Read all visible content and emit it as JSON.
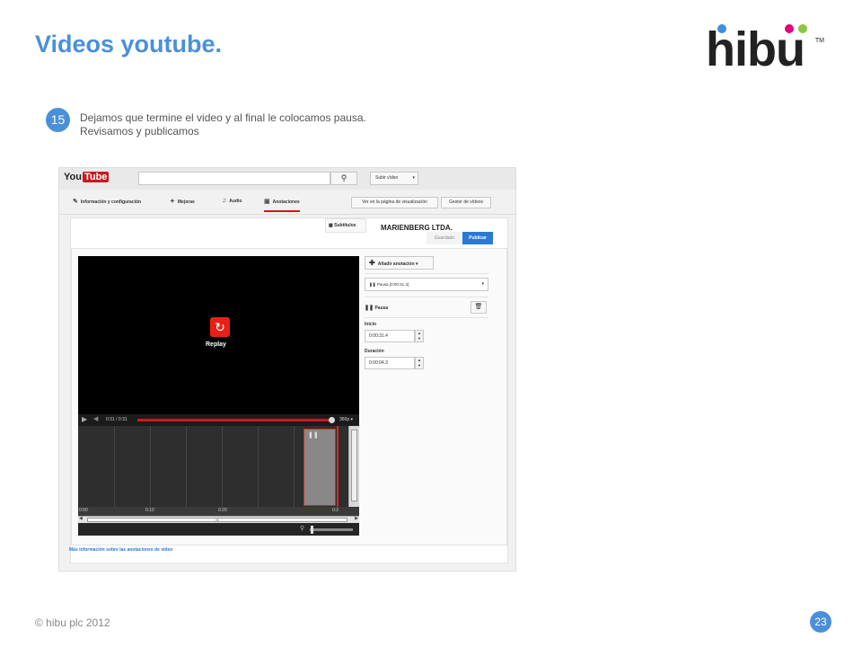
{
  "slide": {
    "title": "Videos youtube.",
    "step_number": "15",
    "step_line1": "Dejamos que termine el video y al final le colocamos pausa.",
    "step_line2": "Revisamos y publicamos",
    "footer": "© hibu plc 2012",
    "page_number": "23"
  },
  "logo": {
    "text": "hibu",
    "tm": "TM",
    "dot_colors": [
      "#3f8fdd",
      "#e4007e",
      "#8cc63f"
    ]
  },
  "youtube": {
    "logo_you": "You",
    "logo_tube": "Tube",
    "search_icon": "search-icon",
    "upload_label": "Subir vídeo",
    "tabs": [
      {
        "label": "Información y configuración",
        "icon": "pencil-icon"
      },
      {
        "label": "Mejoras",
        "icon": "wand-icon"
      },
      {
        "label": "Audio",
        "icon": "music-icon"
      },
      {
        "label": "Anotaciones",
        "icon": "speech-bubble-icon"
      }
    ],
    "view_page_label": "Ver en la página de visualización",
    "video_manager_label": "Gestor de vídeos",
    "subtitles_label": "Subtítulos",
    "channel": "MARIENBERG LTDA.",
    "saved_label": "Guardado",
    "publish_label": "Publicar",
    "replay_label": "Replay",
    "time_readout": "0:31 / 0:31",
    "quality": "360p",
    "ticks": [
      "0:00",
      "0:10",
      "0:20",
      "0:3"
    ],
    "scroll_grip": "III",
    "add_annotation": "Añadir anotación",
    "annotation_select": "Pausa [0:00:31.4]",
    "annotation_type": "Pausa",
    "start_label": "Inicio",
    "start_value": "0:00:31.4",
    "duration_label": "Duración",
    "duration_value": "0:00:04.3",
    "more_info": "Más información sobre las anotaciones de vídeo",
    "accent_red": "#cc181e",
    "accent_blue": "#2b78d5"
  }
}
